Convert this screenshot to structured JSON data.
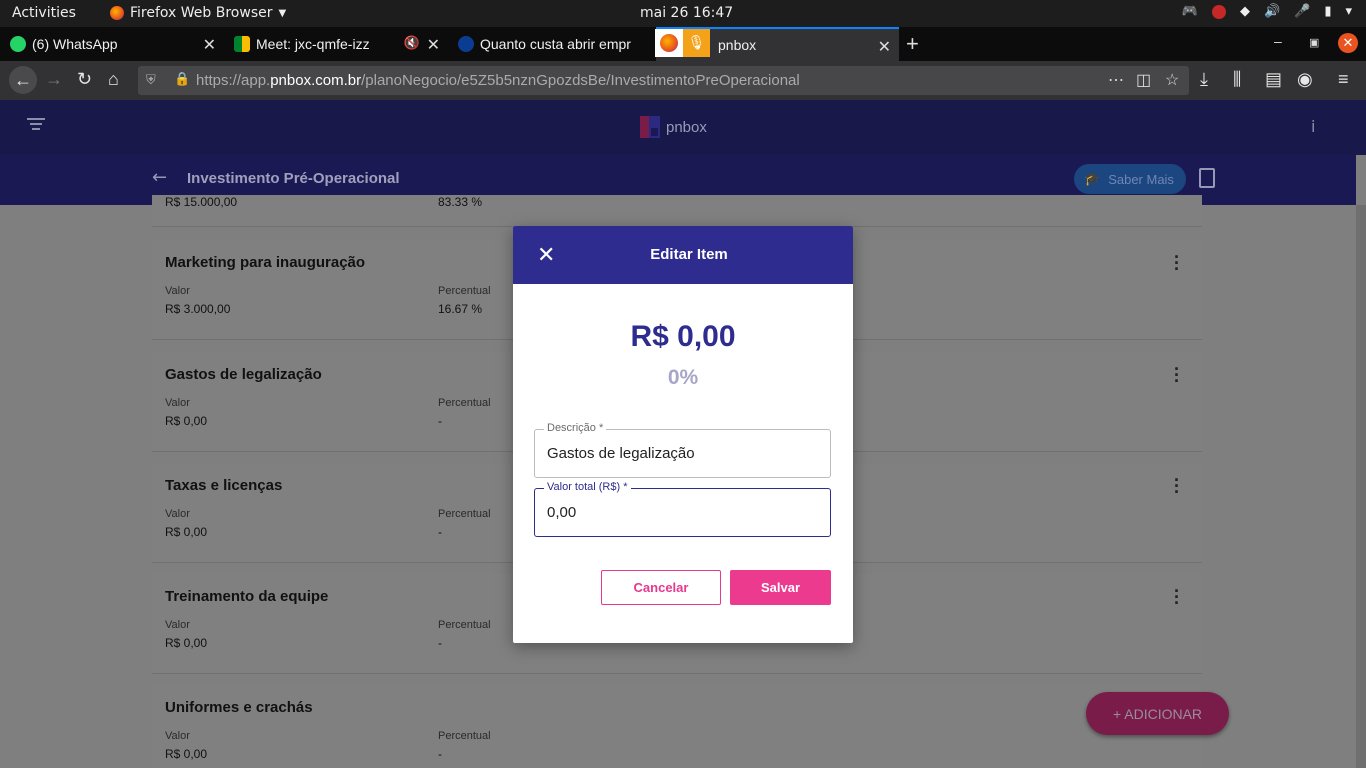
{
  "system": {
    "activities": "Activities",
    "app_name": "Firefox Web Browser",
    "clock": "mai 26  16:47"
  },
  "tabs": [
    {
      "label": "(6) WhatsApp",
      "icon": "whatsapp-icon"
    },
    {
      "label": "Meet: jxc-qmfe-izz",
      "icon": "meet-icon"
    },
    {
      "label": "Quanto custa abrir empr",
      "icon": "site-icon"
    },
    {
      "label": "pnbox",
      "icon": "pnbox-icon"
    }
  ],
  "url": {
    "prefix": "https://app.",
    "host": "pnbox.com.br",
    "path": "/planoNegocio/e5Z5b5nznGpozdsBe/InvestimentoPreOperacional"
  },
  "app": {
    "logo_text": "pnbox",
    "page_title": "Investimento Pré-Operacional",
    "saber_mais": "Saber Mais",
    "fab_label": "+ ADICIONAR"
  },
  "partial_item": {
    "value": "R$ 15.000,00",
    "percent": "83.33 %"
  },
  "items": [
    {
      "name": "Marketing para inauguração",
      "value_label": "Valor",
      "value": "R$ 3.000,00",
      "percent_label": "Percentual",
      "percent": "16.67 %"
    },
    {
      "name": "Gastos de legalização",
      "value_label": "Valor",
      "value": "R$ 0,00",
      "percent_label": "Percentual",
      "percent": "-"
    },
    {
      "name": "Taxas e licenças",
      "value_label": "Valor",
      "value": "R$ 0,00",
      "percent_label": "Percentual",
      "percent": "-"
    },
    {
      "name": "Treinamento da equipe",
      "value_label": "Valor",
      "value": "R$ 0,00",
      "percent_label": "Percentual",
      "percent": "-"
    },
    {
      "name": "Uniformes e crachás",
      "value_label": "Valor",
      "value": "R$ 0,00",
      "percent_label": "Percentual",
      "percent": "-"
    }
  ],
  "modal": {
    "title": "Editar Item",
    "amount": "R$ 0,00",
    "percent": "0%",
    "descricao_label": "Descrição *",
    "descricao_value": "Gastos de legalização",
    "valor_label": "Valor total (R$) *",
    "valor_value": "0,00",
    "cancel": "Cancelar",
    "save": "Salvar"
  },
  "colors": {
    "brand_navy": "#2e2c8f",
    "brand_pink": "#ec3a8e",
    "overlay": "#7f7f7f"
  }
}
